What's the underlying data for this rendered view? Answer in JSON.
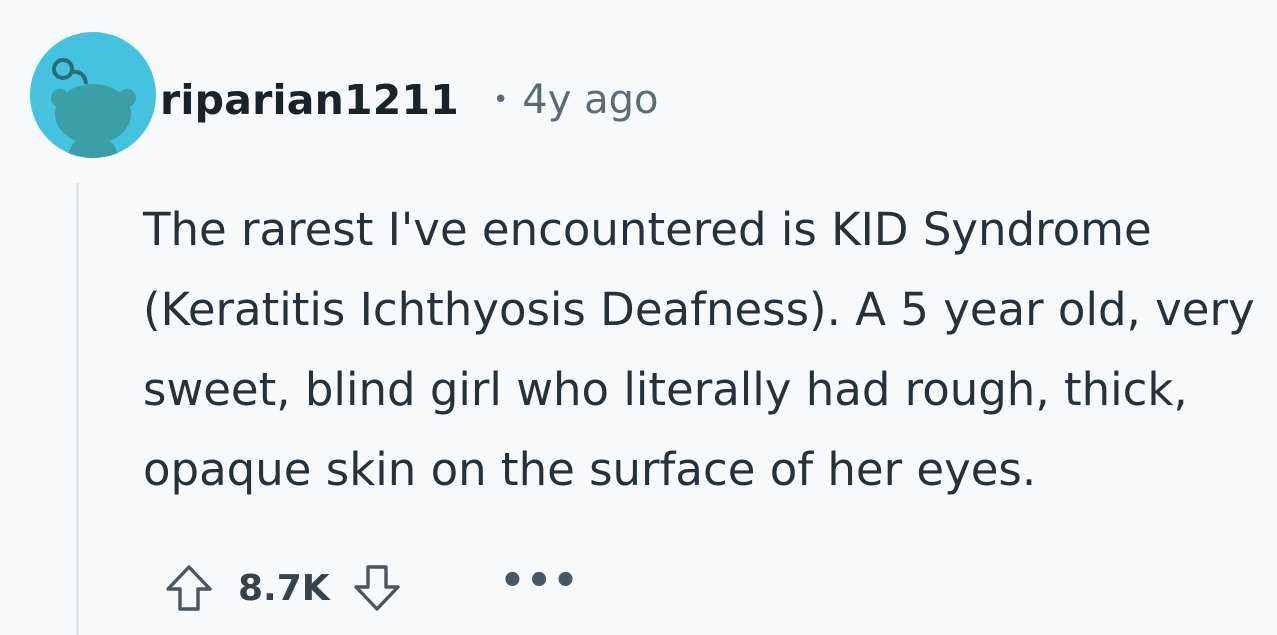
{
  "comment": {
    "author": "riparian1211",
    "separator": "•",
    "age": "4y ago",
    "body": "The rarest I've encountered is KID Syndrome (Keratitis Ichthyosis Deafness). A 5 year old, very sweet, blind girl who literally had rough, thick, opaque skin on the surface of her eyes."
  },
  "actions": {
    "score": "8.7K",
    "more_label": "•••"
  },
  "icons": {
    "avatar": "snoo-avatar-icon",
    "upvote": "upvote-arrow-icon",
    "downvote": "downvote-arrow-icon",
    "more": "more-options-icon"
  },
  "colors": {
    "avatar_background": "#45c2dd",
    "avatar_figure": "#3a9fa8",
    "background": "#f7f9fb",
    "thread_line": "#e0e5e9"
  }
}
